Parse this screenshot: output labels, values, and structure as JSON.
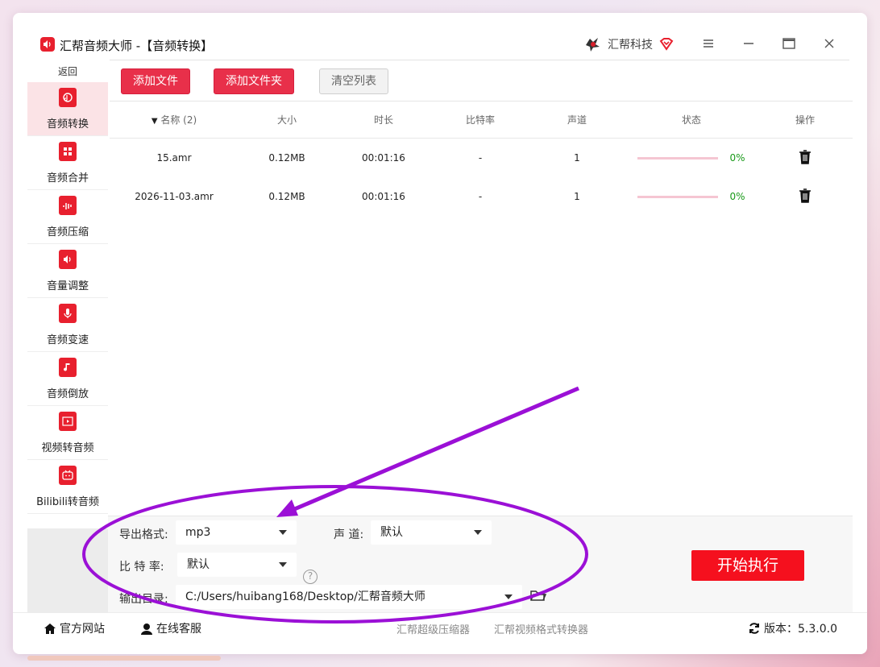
{
  "window": {
    "title": "汇帮音频大师  -【音频转换】"
  },
  "brand": {
    "name": "汇帮科技"
  },
  "sidebar": {
    "back_label": "返回",
    "items": [
      {
        "label": "音频转换",
        "icon": "audio-convert-icon"
      },
      {
        "label": "音频合并",
        "icon": "audio-merge-icon"
      },
      {
        "label": "音频压缩",
        "icon": "audio-compress-icon"
      },
      {
        "label": "音量调整",
        "icon": "volume-adjust-icon"
      },
      {
        "label": "音频变速",
        "icon": "audio-speed-icon"
      },
      {
        "label": "音频倒放",
        "icon": "audio-reverse-icon"
      },
      {
        "label": "视频转音频",
        "icon": "video-to-audio-icon"
      },
      {
        "label": "Bilibili转音频",
        "icon": "bilibili-icon"
      }
    ]
  },
  "toolbar": {
    "add_file": "添加文件",
    "add_folder": "添加文件夹",
    "clear_list": "清空列表"
  },
  "table": {
    "headers": {
      "name": "名称 (2)",
      "size": "大小",
      "duration": "时长",
      "bitrate": "比特率",
      "channel": "声道",
      "status": "状态",
      "action": "操作"
    },
    "rows": [
      {
        "name": "15.amr",
        "size": "0.12MB",
        "duration": "00:01:16",
        "bitrate": "-",
        "channel": "1",
        "progress": "0%"
      },
      {
        "name": "2026-11-03.amr",
        "size": "0.12MB",
        "duration": "00:01:16",
        "bitrate": "-",
        "channel": "1",
        "progress": "0%"
      }
    ]
  },
  "settings": {
    "format_label": "导出格式:",
    "format_value": "mp3",
    "channel_label": "声 道:",
    "channel_value": "默认",
    "bitrate_label": "比 特 率:",
    "bitrate_value": "默认",
    "output_label": "输出目录:",
    "output_value": "C:/Users/huibang168/Desktop/汇帮音频大师",
    "help_glyph": "?",
    "start_button": "开始执行"
  },
  "statusbar": {
    "website": "官方网站",
    "support": "在线客服",
    "link1": "汇帮超级压缩器",
    "link2": "汇帮视频格式转换器",
    "version": "版本：5.3.0.0"
  },
  "colors": {
    "accent": "#e8304a",
    "start": "#f5101e",
    "annotation": "#9b10d6",
    "progress_ok": "#1a9a1a"
  }
}
